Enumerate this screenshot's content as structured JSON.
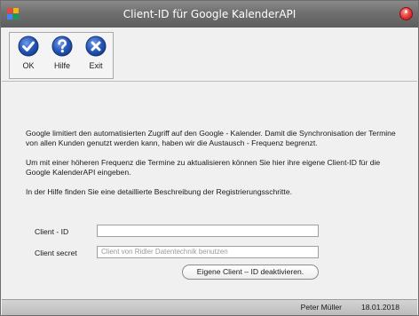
{
  "window": {
    "title": "Client-ID für Google KalenderAPI"
  },
  "toolbar": {
    "ok_label": "OK",
    "help_label": "Hilfe",
    "exit_label": "Exit"
  },
  "content": {
    "paragraph1": "Google limitiert den automatisierten  Zugriff auf den Google - Kalender. Damit die Synchronisation der Termine von  allen Kunden genutzt werden kann, haben wir die Austausch - Frequenz begrenzt.",
    "paragraph2": "Um mit einer höheren Frequenz die Termine zu aktualisieren können Sie hier ihre eigene Client-ID für die Google KalenderAPI eingeben.",
    "paragraph3": "In der Hilfe finden Sie eine detaillierte Beschreibung der Registrierungsschritte.",
    "client_id_label": "Client - ID",
    "client_id_value": "",
    "client_secret_label": "Client secret",
    "client_secret_value": "Client von Ridler Datentechnik benutzen",
    "deactivate_button_label": "Eigene Client – ID deaktivieren."
  },
  "statusbar": {
    "user": "Peter Müller",
    "date": "18.01.2018"
  },
  "colors": {
    "button_icon_blue": "#1f4fa8",
    "titlebar": "#6f6f6f",
    "close_button": "#e53b3b"
  },
  "icons": {
    "ok": "checkmark-icon",
    "help": "question-icon",
    "exit": "close-x-icon"
  }
}
